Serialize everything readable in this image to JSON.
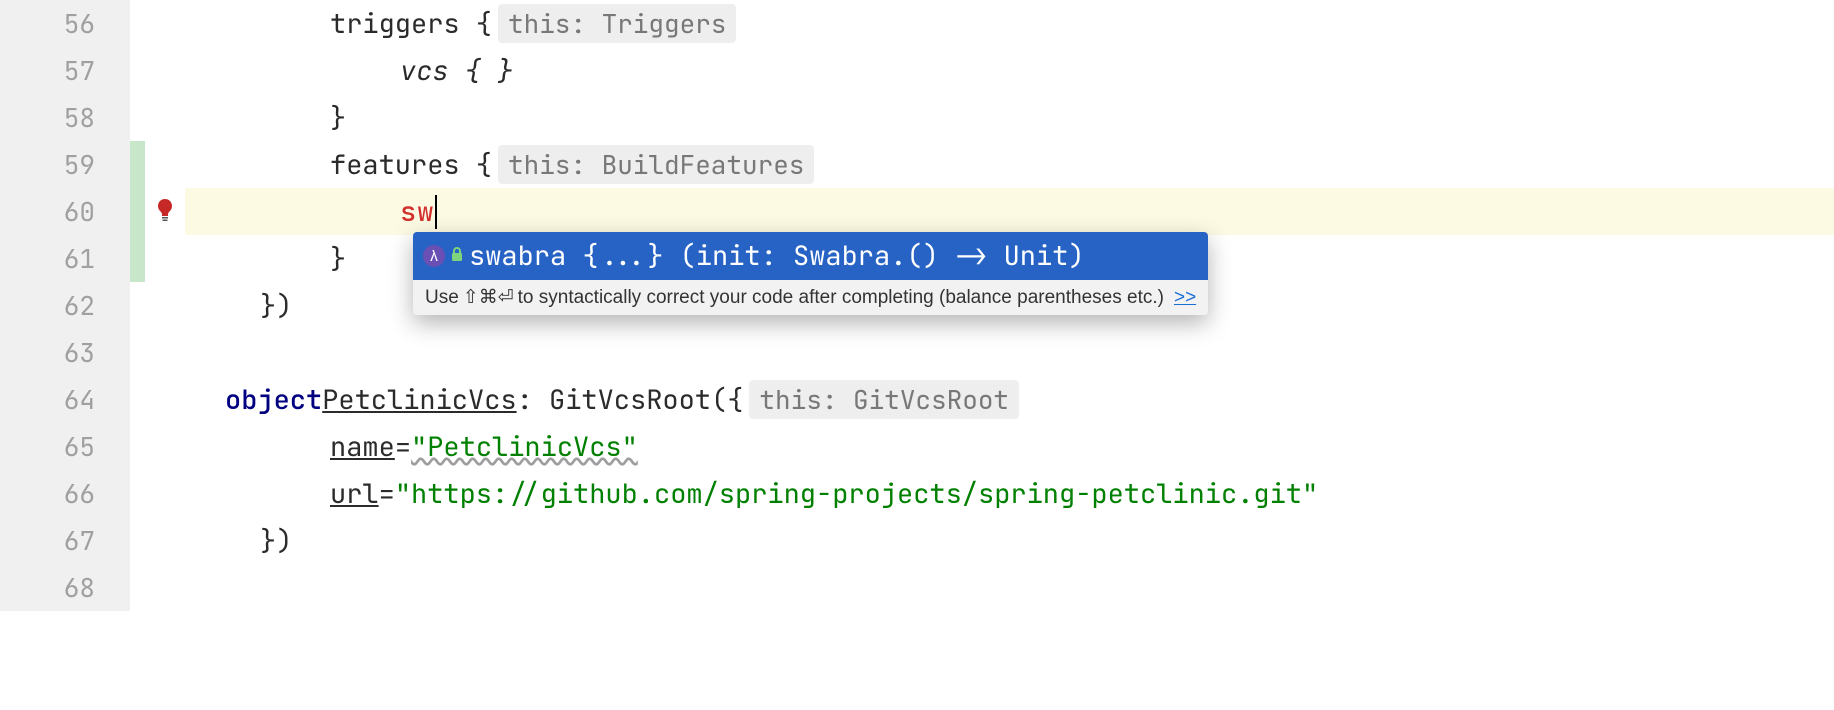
{
  "lines": {
    "l56": "56",
    "l57": "57",
    "l58": "58",
    "l59": "59",
    "l60": "60",
    "l61": "61",
    "l62": "62",
    "l63": "63",
    "l64": "64",
    "l65": "65",
    "l66": "66",
    "l67": "67",
    "l68": "68"
  },
  "code": {
    "triggers": "triggers {",
    "hint_triggers": "this: Triggers",
    "vcs": "vcs { }",
    "brace_close": "}",
    "features": "features {",
    "hint_features": "this: BuildFeatures",
    "sw": "sw",
    "close_paren": "})",
    "object": "object ",
    "petclinic": "PetclinicVcs",
    "colon_git": " : GitVcsRoot({",
    "hint_gitroot": "this: GitVcsRoot",
    "name_prop": "name",
    "equals": " = ",
    "name_val": "\"PetclinicVcs\"",
    "url_prop": "url",
    "url_val": "\"https://github.com/spring-projects/spring-petclinic.git\""
  },
  "completion": {
    "lambda": "λ",
    "text": "swabra {...} (init: Swabra.() -> Unit)",
    "tip_pre": "Use ",
    "tip_keys": "⇧⌘⏎",
    "tip_post": " to syntactically correct your code after completing (balance parentheses etc.)",
    "tip_link": ">>"
  }
}
